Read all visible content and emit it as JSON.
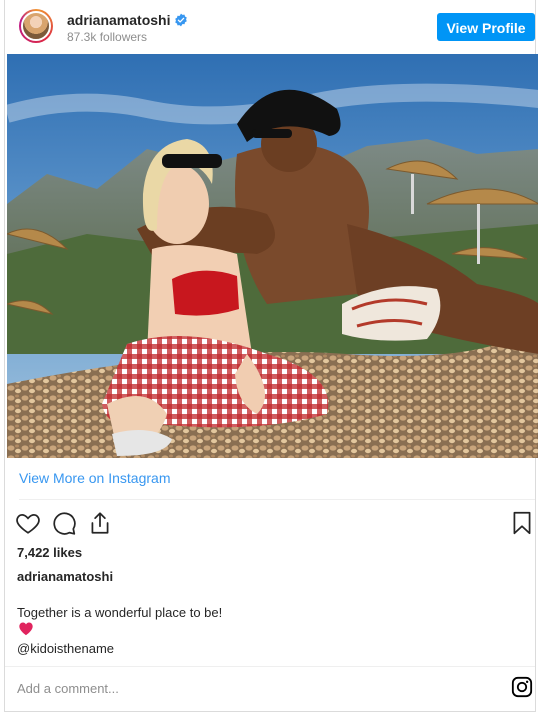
{
  "header": {
    "username": "adrianamatoshi",
    "followers": "87.3k followers",
    "view_profile_label": "View Profile"
  },
  "post": {
    "view_more_label": "View More on Instagram",
    "likes": "7,422 likes",
    "caption_user": "adrianamatoshi",
    "caption_text": "Together is a wonderful place to be!",
    "mention": "@kidoisthename"
  },
  "comment": {
    "placeholder": "Add a comment..."
  },
  "colors": {
    "accent": "#0095f6",
    "link": "#3897f0",
    "heart": "#e0245e"
  },
  "icons": [
    "verified-badge-icon",
    "heart-icon",
    "comment-icon",
    "share-icon",
    "bookmark-icon",
    "heart-emoji-icon",
    "instagram-logo-icon"
  ]
}
